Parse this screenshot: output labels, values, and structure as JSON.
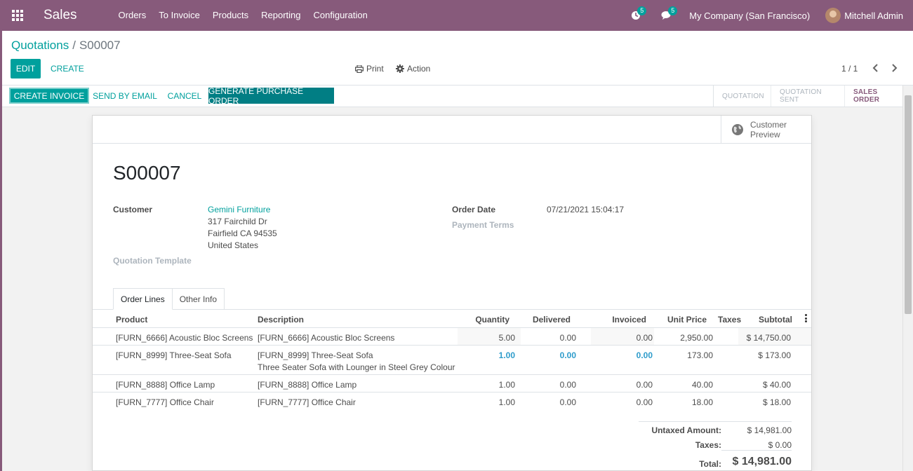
{
  "navbar": {
    "app_name": "Sales",
    "menu": [
      "Orders",
      "To Invoice",
      "Products",
      "Reporting",
      "Configuration"
    ],
    "activity_count": "5",
    "messages_count": "5",
    "company": "My Company (San Francisco)",
    "user": "Mitchell Admin",
    "color": "#875a7b"
  },
  "control": {
    "breadcrumb_parent": "Quotations",
    "breadcrumb_current": "S00007",
    "edit_label": "EDIT",
    "create_label": "CREATE",
    "print_label": "Print",
    "action_label": "Action",
    "pager": "1 / 1"
  },
  "statusbar": {
    "buttons": [
      "CREATE INVOICE",
      "SEND BY EMAIL",
      "CANCEL",
      "GENERATE PURCHASE ORDER"
    ],
    "stages": [
      "QUOTATION",
      "QUOTATION SENT",
      "SALES ORDER"
    ],
    "current_stage": "SALES ORDER"
  },
  "sheet": {
    "customer_preview": "Customer Preview",
    "title": "S00007",
    "customer_label": "Customer",
    "customer_name": "Gemini Furniture",
    "address_line1": "317 Fairchild Dr",
    "address_line2": "Fairfield CA 94535",
    "address_line3": "United States",
    "quotation_template_label": "Quotation Template",
    "order_date_label": "Order Date",
    "order_date": "07/21/2021 15:04:17",
    "payment_terms_label": "Payment Terms",
    "tabs": [
      "Order Lines",
      "Other Info"
    ],
    "columns": [
      "Product",
      "Description",
      "Quantity",
      "Delivered",
      "Invoiced",
      "Unit Price",
      "Taxes",
      "Subtotal"
    ],
    "lines": [
      {
        "product": "[FURN_6666] Acoustic Bloc Screens",
        "description": "[FURN_6666] Acoustic Bloc Screens",
        "description2": "",
        "quantity": "5.00",
        "delivered": "0.00",
        "invoiced": "0.00",
        "unit_price": "2,950.00",
        "taxes": "",
        "subtotal": "$ 14,750.00"
      },
      {
        "product": "[FURN_8999] Three-Seat Sofa",
        "description": "[FURN_8999] Three-Seat Sofa",
        "description2": "Three Seater Sofa with Lounger in Steel Grey Colour",
        "quantity": "1.00",
        "delivered": "0.00",
        "invoiced": "0.00",
        "unit_price": "173.00",
        "taxes": "",
        "subtotal": "$ 173.00"
      },
      {
        "product": "[FURN_8888] Office Lamp",
        "description": "[FURN_8888] Office Lamp",
        "description2": "",
        "quantity": "1.00",
        "delivered": "0.00",
        "invoiced": "0.00",
        "unit_price": "40.00",
        "taxes": "",
        "subtotal": "$ 40.00"
      },
      {
        "product": "[FURN_7777] Office Chair",
        "description": "[FURN_7777] Office Chair",
        "description2": "",
        "quantity": "1.00",
        "delivered": "0.00",
        "invoiced": "0.00",
        "unit_price": "18.00",
        "taxes": "",
        "subtotal": "$ 18.00"
      }
    ],
    "untaxed_label": "Untaxed Amount:",
    "untaxed": "$ 14,981.00",
    "taxes_label": "Taxes:",
    "taxes": "$ 0.00",
    "total_label": "Total:",
    "total": "$ 14,981.00"
  }
}
